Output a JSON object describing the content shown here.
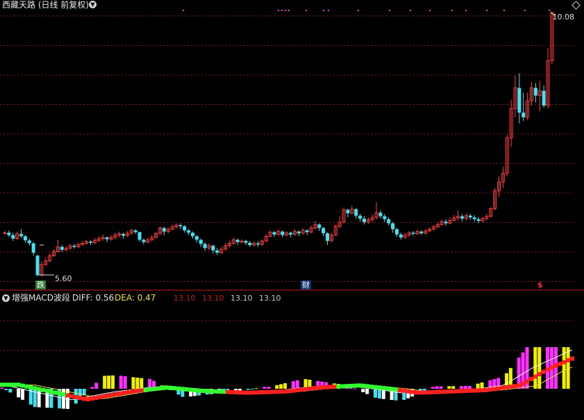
{
  "stock_title": "西藏天路 (日线 前复权)",
  "high_label": "10.08",
  "low_label": "5.60",
  "markers": {
    "die": "跌",
    "cai": "财",
    "s": "$"
  },
  "macd": {
    "title": "增强MACD波段",
    "diff": "DIFF: 0.56",
    "dea": "DEA: 0.47",
    "levels": [
      "13.10",
      "13.10",
      "13.10",
      "13.10"
    ],
    "level_colors": [
      "#c02020",
      "#c02020",
      "#c8c8c8",
      "#c8c8c8"
    ]
  },
  "colors": {
    "up": "#ff3b3b",
    "down": "#46e0f0",
    "grid": "#8a1a1a",
    "zero_line": "#c82020"
  },
  "chart_data": {
    "type": "candlestick",
    "price_low": 5.6,
    "price_high": 10.08,
    "candles": [
      [
        6.34,
        6.34,
        6.31,
        6.37
      ],
      [
        6.34,
        6.3,
        6.27,
        6.38
      ],
      [
        6.3,
        6.24,
        6.2,
        6.34
      ],
      [
        6.24,
        6.32,
        6.22,
        6.36
      ],
      [
        6.32,
        6.28,
        6.25,
        6.4
      ],
      [
        6.28,
        6.21,
        6.17,
        6.3
      ],
      [
        6.21,
        6.16,
        6.12,
        6.24
      ],
      [
        6.16,
        6.0,
        5.95,
        6.18
      ],
      [
        5.95,
        5.62,
        5.6,
        5.97
      ],
      [
        5.62,
        5.8,
        5.6,
        5.85
      ],
      [
        5.8,
        5.86,
        5.78,
        5.92
      ],
      [
        5.86,
        5.95,
        5.84,
        5.99
      ],
      [
        5.95,
        6.02,
        5.93,
        6.06
      ],
      [
        6.02,
        6.1,
        6.0,
        6.22
      ],
      [
        6.1,
        6.05,
        6.01,
        6.13
      ],
      [
        6.05,
        6.08,
        6.03,
        6.11
      ],
      [
        6.08,
        6.12,
        6.05,
        6.15
      ],
      [
        6.12,
        6.1,
        6.07,
        6.15
      ],
      [
        6.1,
        6.14,
        6.08,
        6.17
      ],
      [
        6.14,
        6.16,
        6.12,
        6.2
      ],
      [
        6.16,
        6.19,
        6.14,
        6.22
      ],
      [
        6.19,
        6.17,
        6.13,
        6.21
      ],
      [
        6.17,
        6.21,
        6.15,
        6.25
      ],
      [
        6.21,
        6.24,
        6.18,
        6.28
      ],
      [
        6.24,
        6.26,
        6.2,
        6.31
      ],
      [
        6.26,
        6.23,
        6.18,
        6.28
      ],
      [
        6.23,
        6.26,
        6.2,
        6.3
      ],
      [
        6.26,
        6.3,
        6.23,
        6.34
      ],
      [
        6.3,
        6.32,
        6.26,
        6.36
      ],
      [
        6.32,
        6.29,
        6.24,
        6.34
      ],
      [
        6.29,
        6.33,
        6.27,
        6.37
      ],
      [
        6.33,
        6.38,
        6.3,
        6.41
      ],
      [
        6.38,
        6.35,
        6.32,
        6.4
      ],
      [
        6.35,
        6.22,
        6.19,
        6.36
      ],
      [
        6.22,
        6.18,
        6.14,
        6.24
      ],
      [
        6.18,
        6.22,
        6.16,
        6.26
      ],
      [
        6.22,
        6.26,
        6.2,
        6.3
      ],
      [
        6.26,
        6.33,
        6.24,
        6.35
      ],
      [
        6.33,
        6.42,
        6.3,
        6.45
      ],
      [
        6.42,
        6.36,
        6.3,
        6.44
      ],
      [
        6.36,
        6.4,
        6.33,
        6.43
      ],
      [
        6.4,
        6.44,
        6.38,
        6.48
      ],
      [
        6.44,
        6.47,
        6.41,
        6.5
      ],
      [
        6.47,
        6.45,
        6.4,
        6.5
      ],
      [
        6.45,
        6.38,
        6.34,
        6.47
      ],
      [
        6.38,
        6.34,
        6.3,
        6.4
      ],
      [
        6.34,
        6.28,
        6.24,
        6.36
      ],
      [
        6.28,
        6.22,
        6.17,
        6.3
      ],
      [
        6.22,
        6.15,
        6.1,
        6.24
      ],
      [
        6.15,
        6.08,
        6.03,
        6.18
      ],
      [
        6.08,
        6.12,
        6.04,
        6.16
      ],
      [
        6.12,
        6.04,
        5.99,
        6.14
      ],
      [
        6.04,
        6.0,
        5.96,
        6.08
      ],
      [
        6.0,
        6.06,
        5.98,
        6.1
      ],
      [
        6.06,
        6.12,
        6.04,
        6.16
      ],
      [
        6.12,
        6.16,
        6.09,
        6.2
      ],
      [
        6.16,
        6.22,
        6.14,
        6.26
      ],
      [
        6.22,
        6.18,
        6.13,
        6.24
      ],
      [
        6.18,
        6.2,
        6.15,
        6.23
      ],
      [
        6.2,
        6.17,
        6.13,
        6.22
      ],
      [
        6.17,
        6.13,
        6.1,
        6.2
      ],
      [
        6.13,
        6.16,
        6.11,
        6.19
      ],
      [
        6.16,
        6.14,
        6.1,
        6.2
      ],
      [
        6.14,
        6.2,
        6.12,
        6.23
      ],
      [
        6.2,
        6.28,
        6.18,
        6.31
      ],
      [
        6.28,
        6.35,
        6.26,
        6.38
      ],
      [
        6.35,
        6.31,
        6.27,
        6.37
      ],
      [
        6.31,
        6.36,
        6.29,
        6.4
      ],
      [
        6.36,
        6.3,
        6.26,
        6.38
      ],
      [
        6.3,
        6.34,
        6.28,
        6.37
      ],
      [
        6.34,
        6.31,
        6.26,
        6.36
      ],
      [
        6.31,
        6.36,
        6.29,
        6.4
      ],
      [
        6.36,
        6.33,
        6.28,
        6.38
      ],
      [
        6.33,
        6.38,
        6.31,
        6.42
      ],
      [
        6.38,
        6.35,
        6.3,
        6.4
      ],
      [
        6.35,
        6.42,
        6.33,
        6.46
      ],
      [
        6.42,
        6.48,
        6.4,
        6.54
      ],
      [
        6.48,
        6.42,
        6.37,
        6.5
      ],
      [
        6.42,
        6.33,
        6.28,
        6.44
      ],
      [
        6.33,
        6.2,
        6.13,
        6.35
      ],
      [
        6.2,
        6.3,
        6.18,
        6.34
      ],
      [
        6.3,
        6.45,
        6.28,
        6.48
      ],
      [
        6.45,
        6.52,
        6.42,
        6.62
      ],
      [
        6.52,
        6.73,
        6.5,
        6.77
      ],
      [
        6.73,
        6.67,
        6.6,
        6.75
      ],
      [
        6.67,
        6.74,
        6.65,
        6.8
      ],
      [
        6.74,
        6.63,
        6.58,
        6.76
      ],
      [
        6.63,
        6.58,
        6.53,
        6.66
      ],
      [
        6.58,
        6.52,
        6.48,
        6.62
      ],
      [
        6.52,
        6.56,
        6.49,
        6.6
      ],
      [
        6.56,
        6.6,
        6.53,
        6.65
      ],
      [
        6.6,
        6.68,
        6.57,
        6.86
      ],
      [
        6.68,
        6.62,
        6.58,
        6.72
      ],
      [
        6.62,
        6.57,
        6.52,
        6.66
      ],
      [
        6.57,
        6.5,
        6.46,
        6.6
      ],
      [
        6.5,
        6.4,
        6.34,
        6.52
      ],
      [
        6.4,
        6.31,
        6.27,
        6.42
      ],
      [
        6.31,
        6.26,
        6.22,
        6.34
      ],
      [
        6.26,
        6.3,
        6.24,
        6.34
      ],
      [
        6.3,
        6.34,
        6.27,
        6.37
      ],
      [
        6.34,
        6.32,
        6.29,
        6.37
      ],
      [
        6.32,
        6.36,
        6.3,
        6.39
      ],
      [
        6.36,
        6.33,
        6.3,
        6.38
      ],
      [
        6.33,
        6.37,
        6.31,
        6.4
      ],
      [
        6.37,
        6.4,
        6.35,
        6.43
      ],
      [
        6.4,
        6.44,
        6.38,
        6.47
      ],
      [
        6.44,
        6.48,
        6.42,
        6.52
      ],
      [
        6.48,
        6.53,
        6.46,
        6.56
      ],
      [
        6.53,
        6.5,
        6.46,
        6.57
      ],
      [
        6.5,
        6.55,
        6.48,
        6.6
      ],
      [
        6.55,
        6.59,
        6.53,
        6.64
      ],
      [
        6.59,
        6.62,
        6.55,
        6.72
      ],
      [
        6.62,
        6.58,
        6.53,
        6.66
      ],
      [
        6.58,
        6.63,
        6.55,
        6.67
      ],
      [
        6.63,
        6.6,
        6.56,
        6.66
      ],
      [
        6.6,
        6.57,
        6.53,
        6.64
      ],
      [
        6.57,
        6.54,
        6.5,
        6.61
      ],
      [
        6.54,
        6.58,
        6.52,
        6.61
      ],
      [
        6.58,
        6.62,
        6.55,
        6.66
      ],
      [
        6.62,
        6.75,
        6.6,
        6.78
      ],
      [
        6.75,
        7.05,
        6.72,
        7.1
      ],
      [
        7.05,
        7.2,
        6.95,
        7.3
      ],
      [
        7.2,
        7.35,
        7.1,
        7.46
      ],
      [
        7.35,
        7.95,
        7.3,
        8.0
      ],
      [
        7.95,
        8.45,
        7.8,
        8.6
      ],
      [
        8.45,
        8.8,
        8.3,
        9.01
      ],
      [
        8.8,
        8.38,
        8.2,
        9.05
      ],
      [
        8.38,
        8.3,
        8.24,
        8.72
      ],
      [
        8.3,
        8.58,
        8.25,
        8.72
      ],
      [
        8.58,
        8.8,
        8.5,
        8.9
      ],
      [
        8.8,
        8.67,
        8.55,
        8.88
      ],
      [
        8.67,
        8.75,
        8.4,
        8.92
      ],
      [
        8.75,
        8.5,
        8.46,
        8.84
      ],
      [
        8.5,
        9.26,
        8.45,
        9.48
      ],
      [
        9.26,
        10.08,
        9.2,
        10.1
      ]
    ]
  }
}
